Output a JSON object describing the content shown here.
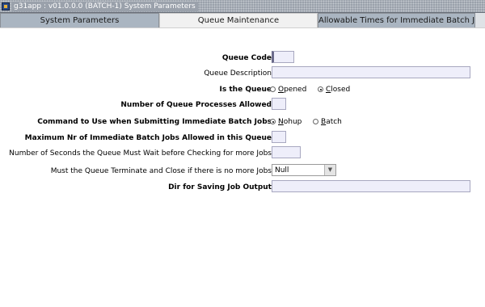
{
  "window": {
    "title": "g31app : v01.0.0.0 (BATCH-1) System Parameters"
  },
  "tabs": [
    {
      "label": "System Parameters"
    },
    {
      "label": "Queue Maintenance"
    },
    {
      "label": "Allowable Times for Immediate Batch Jobs"
    }
  ],
  "form": {
    "queue_code": {
      "label": "Queue Code",
      "value": ""
    },
    "queue_description": {
      "label": "Queue Description",
      "value": ""
    },
    "is_queue": {
      "label": "Is the Queue",
      "options": [
        {
          "label": "Opened",
          "hotkey": "O",
          "rest": "pened",
          "selected": false
        },
        {
          "label": "Closed",
          "hotkey": "C",
          "rest": "losed",
          "selected": true
        }
      ]
    },
    "num_processes": {
      "label": "Number of Queue Processes Allowed",
      "value": ""
    },
    "command": {
      "label": "Command to Use when Submitting Immediate Batch Jobs",
      "options": [
        {
          "label": "Nohup",
          "hotkey": "N",
          "rest": "ohup",
          "selected": true
        },
        {
          "label": "Batch",
          "hotkey": "B",
          "rest": "atch",
          "selected": false
        }
      ]
    },
    "max_immediate": {
      "label": "Maximum Nr of Immediate Batch Jobs Allowed in this Queue",
      "value": ""
    },
    "wait_seconds": {
      "label": "Number of Seconds the Queue Must Wait before Checking for more Jobs",
      "value": ""
    },
    "terminate": {
      "label": "Must the Queue Terminate and Close if there is no more Jobs",
      "value": "Null"
    },
    "output_dir": {
      "label": "Dir for Saving Job Output",
      "value": ""
    }
  }
}
